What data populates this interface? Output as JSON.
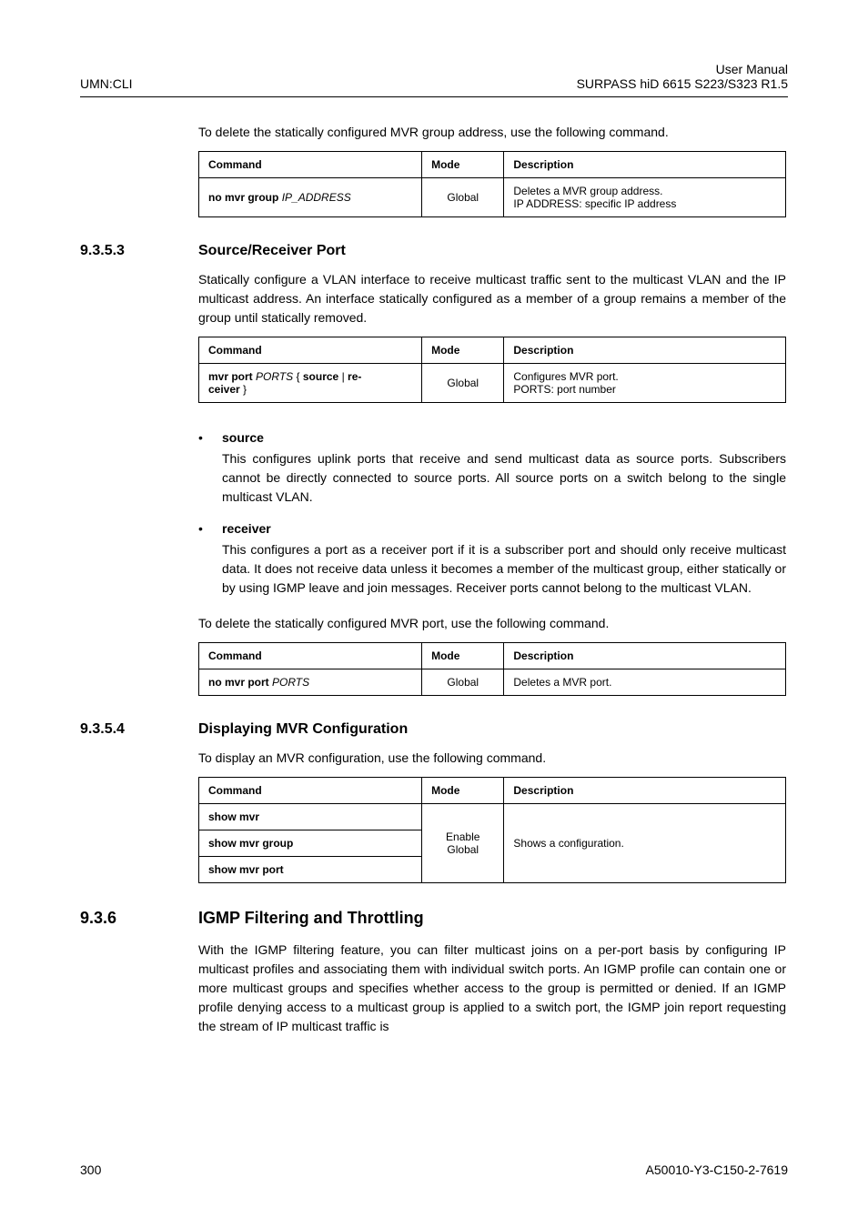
{
  "header": {
    "left": "UMN:CLI",
    "right_l1": "User Manual",
    "right_l2": "SURPASS hiD 6615 S223/S323 R1.5"
  },
  "intro1": "To delete the statically configured MVR group address, use the following command.",
  "table_headers": {
    "cmd": "Command",
    "mode": "Mode",
    "desc": "Description"
  },
  "t1": {
    "cmd_b": "no mvr group",
    "cmd_i": "IP_ADDRESS",
    "mode": "Global",
    "desc_l1": "Deletes a MVR group address.",
    "desc_l2": "IP ADDRESS: specific IP address"
  },
  "sec1": {
    "num": "9.3.5.3",
    "title": "Source/Receiver Port"
  },
  "para1": "Statically configure a VLAN interface to receive multicast traffic sent to the multicast VLAN and the IP multicast address. An interface statically configured as a member of a group remains a member of the group until statically removed.",
  "t2": {
    "cmd_b1": "mvr port",
    "cmd_i1": "PORTS",
    "cmd_p1": "{",
    "cmd_b2": "source",
    "cmd_p2": "|",
    "cmd_b3": "re-",
    "cmd_b4": "ceiver",
    "cmd_p3": "}",
    "mode": "Global",
    "desc_l1": "Configures MVR port.",
    "desc_l2": "PORTS: port number"
  },
  "bullets": {
    "b1_lead": "source",
    "b1_body": "This configures uplink ports that receive and send multicast data as source ports. Subscribers cannot be directly connected to source ports. All source ports on a switch belong to the single multicast VLAN.",
    "b2_lead": "receiver",
    "b2_body": "This configures a port as a receiver port if it is a subscriber port and should only receive multicast data. It does not receive data unless it becomes a member of the multicast group, either statically or by using IGMP leave and join messages. Receiver ports cannot belong to the multicast VLAN."
  },
  "para2": "To delete the statically configured MVR port, use the following command.",
  "t3": {
    "cmd_b": "no mvr port",
    "cmd_i": "PORTS",
    "mode": "Global",
    "desc": "Deletes a MVR port."
  },
  "sec2": {
    "num": "9.3.5.4",
    "title": "Displaying MVR Configuration"
  },
  "para3": "To display an MVR configuration, use the following command.",
  "t4": {
    "r1_cmd": "show mvr",
    "r2_cmd": "show mvr group",
    "r3_cmd": "show mvr port",
    "mode_l1": "Enable",
    "mode_l2": "Global",
    "desc": "Shows a configuration."
  },
  "sec3": {
    "num": "9.3.6",
    "title": "IGMP Filtering and Throttling"
  },
  "para4": "With the IGMP filtering feature, you can filter multicast joins on a per-port basis by configuring IP multicast profiles and associating them with individual switch ports. An IGMP profile can contain one or more multicast groups and specifies whether access to the group is permitted or denied. If an IGMP profile denying access to a multicast group is applied to a switch port, the IGMP join report requesting the stream of IP multicast traffic is",
  "footer": {
    "left": "300",
    "right": "A50010-Y3-C150-2-7619"
  }
}
